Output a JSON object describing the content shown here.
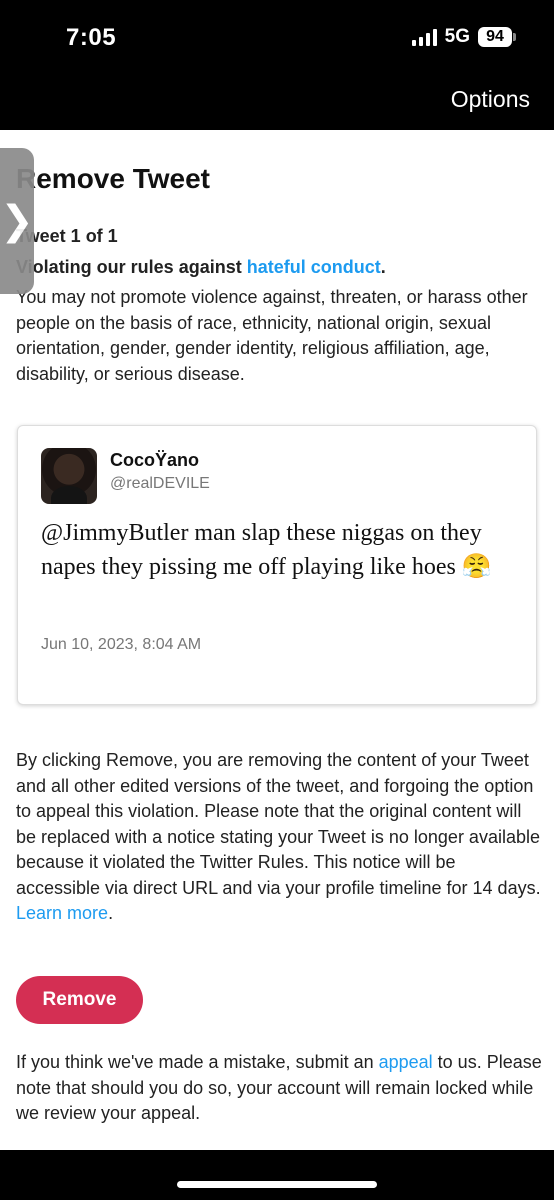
{
  "status_bar": {
    "time": "7:05",
    "network": "5G",
    "battery": "94"
  },
  "header": {
    "options_label": "Options"
  },
  "main": {
    "title": "Remove Tweet",
    "tweet_counter": "Tweet 1 of 1",
    "rule_prefix": "Violating our rules against ",
    "rule_link": "hateful conduct",
    "rule_suffix": ".",
    "rule_description": "You may not promote violence against, threaten, or harass other people on the basis of race, ethnicity, national origin, sexual orientation, gender, gender identity, religious affiliation, age, disability, or serious disease.",
    "tweet": {
      "display_name": "CocoŸano",
      "handle": "@realDEVILE",
      "text": "@JimmyButler man slap these niggas on they napes they pissing me off playing like hoes 😤",
      "date": "Jun 10, 2023, 8:04 AM"
    },
    "notice": "By clicking Remove, you are removing the content of your Tweet and all other edited versions of the tweet, and forgoing the option to appeal this violation. Please note that the original content will be replaced with a notice stating your Tweet is no longer available because it violated the Twitter Rules. This notice will be accessible via direct URL and via your profile timeline for 14 days. ",
    "learn_more": "Learn more",
    "notice_end": ".",
    "remove_label": "Remove",
    "appeal_prefix": "If you think we've made a mistake, submit an ",
    "appeal_link": "appeal",
    "appeal_suffix": " to us. Please note that should you do so, your account will remain locked while we review your appeal."
  },
  "drawer": {
    "chevron": "❯"
  },
  "colors": {
    "link": "#1d9bf0",
    "remove_button": "#d42f53"
  }
}
